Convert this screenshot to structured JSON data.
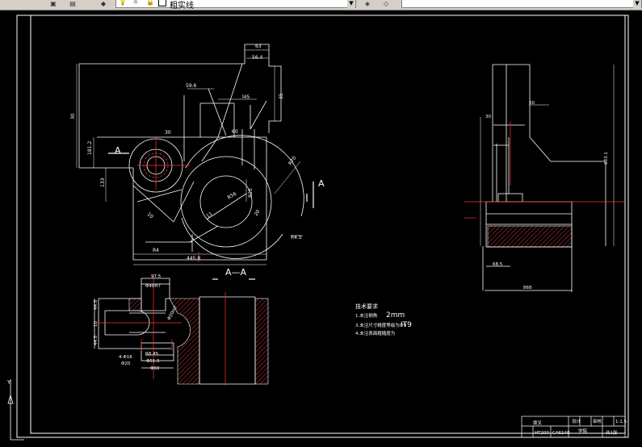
{
  "toolbar": {
    "layer_name": "粗实线",
    "icons": [
      "layer-manager-icon",
      "layer-state-icon",
      "bulb-icon",
      "sun-icon",
      "layer-combo-lock-icon",
      "color-swatch-icon",
      "match-layer-icon",
      "layer-previous-icon"
    ]
  },
  "colors": {
    "background": "#000000",
    "geometry": "#ffffff",
    "centerline": "#ff0000",
    "hatch": "#a52a2a",
    "toolbar": "#d4d0c8"
  },
  "drawing": {
    "section_marker_left": "A",
    "section_marker_right": "A",
    "section_title": "A—A",
    "main_view_dims": [
      "63",
      "56.4",
      "59.6",
      "l45",
      "35",
      "30",
      "181.2",
      "133",
      "30",
      "60",
      "R70",
      "R56",
      "R25",
      "20",
      "11",
      "445.8",
      "R4",
      "R4.5",
      "10"
    ],
    "bottom_view_dims": [
      "97.5",
      "Φ40H7",
      "44.5",
      "10",
      "44.5",
      "4-Φ16",
      "Φ20H7",
      "Φ20",
      "Φ60",
      "R8.45",
      "Φ51.5"
    ],
    "right_view_dims": [
      "30",
      "60",
      "633.1",
      "68.5",
      "868"
    ],
    "notes_title": "技术要求",
    "notes": [
      "1.未注倒角",
      "2.未注公差按照2mm",
      "3.未注尺寸精度等级为IT9",
      "4.未注表面粗糙度为"
    ],
    "notes_values": [
      "2mm",
      "IT9"
    ]
  },
  "title_block": {
    "part_name": "拨叉",
    "material": "HT200",
    "scale": "1:1.5",
    "drawing_no": "CA6140",
    "school": "学院",
    "designer": "设计",
    "checker": "审核",
    "sheet": "共1张"
  },
  "ucs": {
    "y_label": "Y",
    "x_label": "X"
  }
}
